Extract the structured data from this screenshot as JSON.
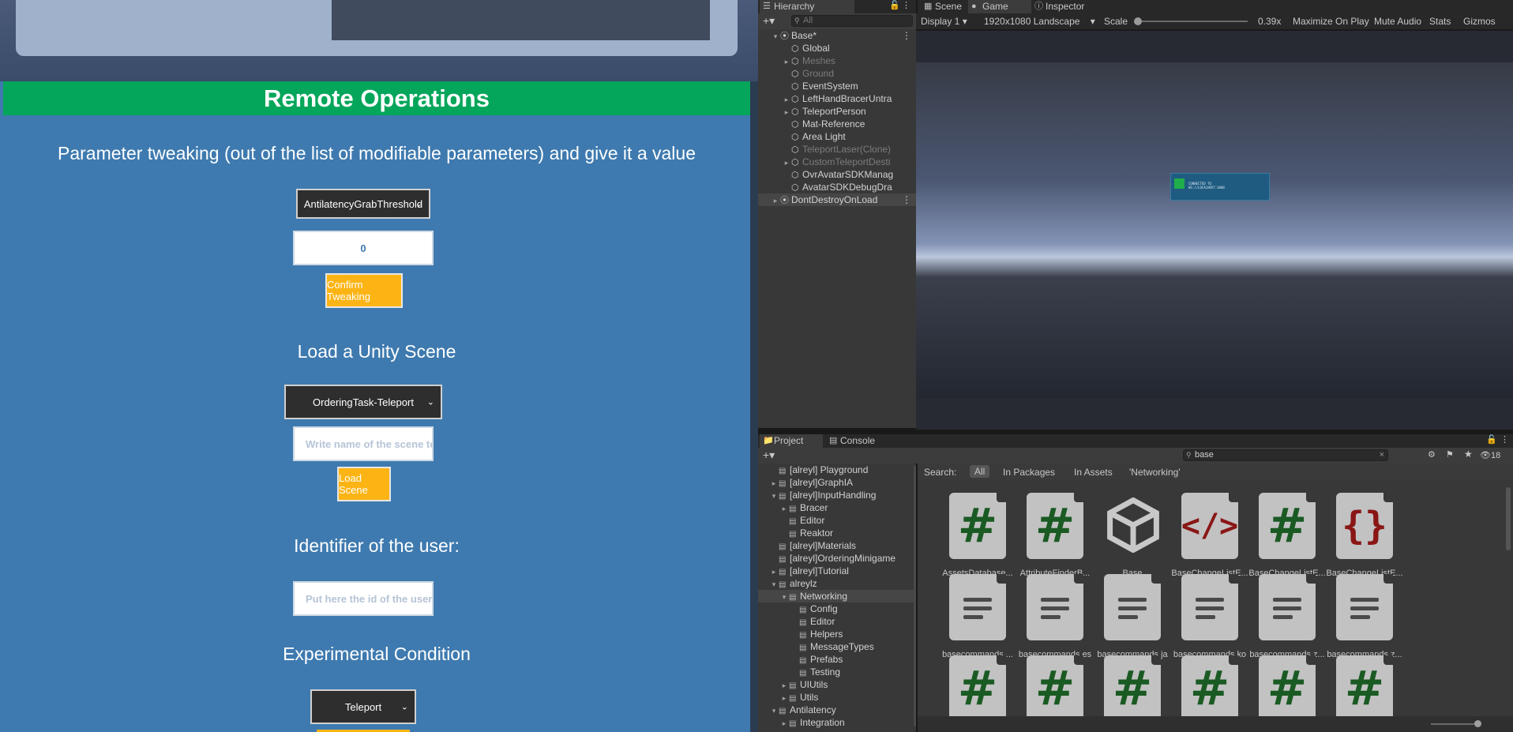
{
  "browser": {
    "section_title": "Remote Operations",
    "param": {
      "heading": "Parameter tweaking (out of the list of modifiable parameters) and give it a value",
      "select_value": "AntilatencyGrabThreshold",
      "value_input": "0",
      "confirm_label": "Confirm Tweaking"
    },
    "scene": {
      "heading": "Load a Unity Scene",
      "select_value": "OrderingTask-Teleport",
      "input_placeholder": "Write name of the scene to lo",
      "load_label": "Load Scene"
    },
    "user": {
      "heading": "Identifier of the user:",
      "input_placeholder": "Put here the id of the user, to"
    },
    "condition": {
      "heading": "Experimental Condition",
      "select_value": "Teleport"
    }
  },
  "hierarchy": {
    "tab_label": "Hierarchy",
    "search_placeholder": "All",
    "items": [
      {
        "label": "Base*",
        "type": "scene"
      },
      {
        "label": "Global",
        "type": "obj"
      },
      {
        "label": "Meshes",
        "type": "obj",
        "dim": true,
        "arrow": true
      },
      {
        "label": "Ground",
        "type": "obj",
        "dim": true
      },
      {
        "label": "EventSystem",
        "type": "obj"
      },
      {
        "label": "LeftHandBracerUntra",
        "type": "obj",
        "arrow": true
      },
      {
        "label": "TeleportPerson",
        "type": "obj",
        "arrow": true
      },
      {
        "label": "Mat-Reference",
        "type": "obj"
      },
      {
        "label": "Area Light",
        "type": "obj"
      },
      {
        "label": "TeleportLaser(Clone)",
        "type": "obj",
        "dim": true
      },
      {
        "label": "CustomTeleportDesti",
        "type": "obj",
        "dim": true,
        "arrow": true
      },
      {
        "label": "OvrAvatarSDKManag",
        "type": "obj"
      },
      {
        "label": "AvatarSDKDebugDra",
        "type": "obj"
      },
      {
        "label": "DontDestroyOnLoad",
        "type": "scene"
      }
    ]
  },
  "scene_tabs": {
    "scene": "Scene",
    "game": "Game",
    "inspector": "Inspector"
  },
  "game_toolbar": {
    "display": "Display 1",
    "resolution": "1920x1080 Landscape",
    "scale_label": "Scale",
    "scale_value": "0.39x",
    "maximize": "Maximize On Play",
    "mute": "Mute Audio",
    "stats": "Stats",
    "gizmos": "Gizmos"
  },
  "game_view": {
    "panel_text_1": "CONNECTED TO",
    "panel_text_2": "WS://LOCALHOST:3000"
  },
  "project": {
    "tab_project": "Project",
    "tab_console": "Console",
    "search_value": "base",
    "hidden_count": "18",
    "search_label": "Search:",
    "filters": [
      "All",
      "In Packages",
      "In Assets",
      "'Networking'"
    ],
    "tree": [
      {
        "label": "[alreyl] Playground",
        "depth": 1,
        "arrow": false
      },
      {
        "label": "[alreyl]GraphIA",
        "depth": 1,
        "arrow": true
      },
      {
        "label": "[alreyl]InputHandling",
        "depth": 1,
        "arrow": "open"
      },
      {
        "label": "Bracer",
        "depth": 2,
        "arrow": true
      },
      {
        "label": "Editor",
        "depth": 2,
        "arrow": false
      },
      {
        "label": "Reaktor",
        "depth": 2,
        "arrow": false
      },
      {
        "label": "[alreyl]Materials",
        "depth": 1,
        "arrow": false
      },
      {
        "label": "[alreyl]OrderingMinigame",
        "depth": 1,
        "arrow": false
      },
      {
        "label": "[alreyl]Tutorial",
        "depth": 1,
        "arrow": true
      },
      {
        "label": "alreylz",
        "depth": 1,
        "arrow": "open"
      },
      {
        "label": "Networking",
        "depth": 2,
        "arrow": "open",
        "selected": true
      },
      {
        "label": "Config",
        "depth": 3,
        "arrow": false
      },
      {
        "label": "Editor",
        "depth": 3,
        "arrow": false
      },
      {
        "label": "Helpers",
        "depth": 3,
        "arrow": false
      },
      {
        "label": "MessageTypes",
        "depth": 3,
        "arrow": false
      },
      {
        "label": "Prefabs",
        "depth": 3,
        "arrow": false
      },
      {
        "label": "Testing",
        "depth": 3,
        "arrow": false
      },
      {
        "label": "UIUtils",
        "depth": 2,
        "arrow": true
      },
      {
        "label": "Utils",
        "depth": 2,
        "arrow": true
      },
      {
        "label": "Antilatency",
        "depth": 1,
        "arrow": "open"
      },
      {
        "label": "Integration",
        "depth": 2,
        "arrow": true
      }
    ],
    "assets_row1": [
      {
        "label": "AssetsDatabase...",
        "icon": "csharp-script"
      },
      {
        "label": "AttributeFinderB...",
        "icon": "csharp-script"
      },
      {
        "label": "Base",
        "icon": "unity-scene"
      },
      {
        "label": "BaseChangeListE...",
        "icon": "code-file"
      },
      {
        "label": "BaseChangeListE...",
        "icon": "csharp-script"
      },
      {
        "label": "BaseChangeListE...",
        "icon": "json-file"
      }
    ],
    "assets_row2": [
      {
        "label": "basecommands....",
        "icon": "text-file"
      },
      {
        "label": "basecommands.es",
        "icon": "text-file"
      },
      {
        "label": "basecommands.ja",
        "icon": "text-file"
      },
      {
        "label": "basecommands.ko",
        "icon": "text-file"
      },
      {
        "label": "basecommands.z...",
        "icon": "text-file"
      },
      {
        "label": "basecommands.z...",
        "icon": "text-file"
      }
    ]
  }
}
